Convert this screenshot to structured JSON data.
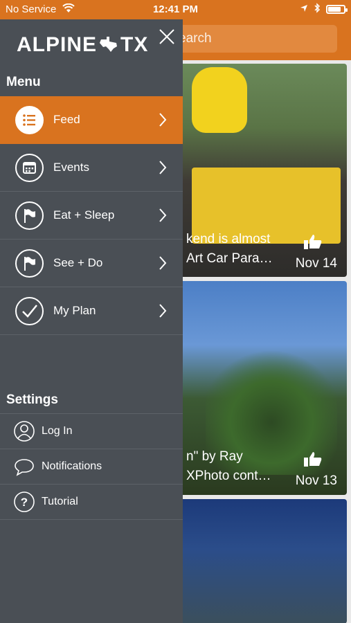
{
  "status_bar": {
    "carrier": "No Service",
    "time": "12:41 PM",
    "battery_level": 0.8
  },
  "header": {
    "search_placeholder": "Search",
    "visible_search_text": "earch",
    "accent_color": "#d9731f"
  },
  "drawer": {
    "logo_text_left": "ALPINE",
    "logo_text_right": "TX",
    "close_icon": "close-icon",
    "menu_heading": "Menu",
    "menu_items": [
      {
        "label": "Feed",
        "icon": "list-icon",
        "active": true
      },
      {
        "label": "Events",
        "icon": "calendar-icon",
        "active": false
      },
      {
        "label": "Eat + Sleep",
        "icon": "flag-icon",
        "active": false
      },
      {
        "label": "See + Do",
        "icon": "flag-icon",
        "active": false
      },
      {
        "label": "My Plan",
        "icon": "checkmark-icon",
        "active": false
      }
    ],
    "settings_heading": "Settings",
    "settings_items": [
      {
        "label": "Log In",
        "icon": "user-icon"
      },
      {
        "label": "Notifications",
        "icon": "speech-bubble-icon"
      },
      {
        "label": "Tutorial",
        "icon": "help-icon"
      }
    ]
  },
  "feed": {
    "cards": [
      {
        "title_line1": "kend is almost",
        "title_line2": "Art Car Para…",
        "date": "Nov 14"
      },
      {
        "title_line1": "n\" by Ray",
        "title_line2": "XPhoto cont…",
        "date": "Nov 13"
      },
      {
        "title_line1": "",
        "title_line2": "",
        "date": ""
      }
    ]
  }
}
